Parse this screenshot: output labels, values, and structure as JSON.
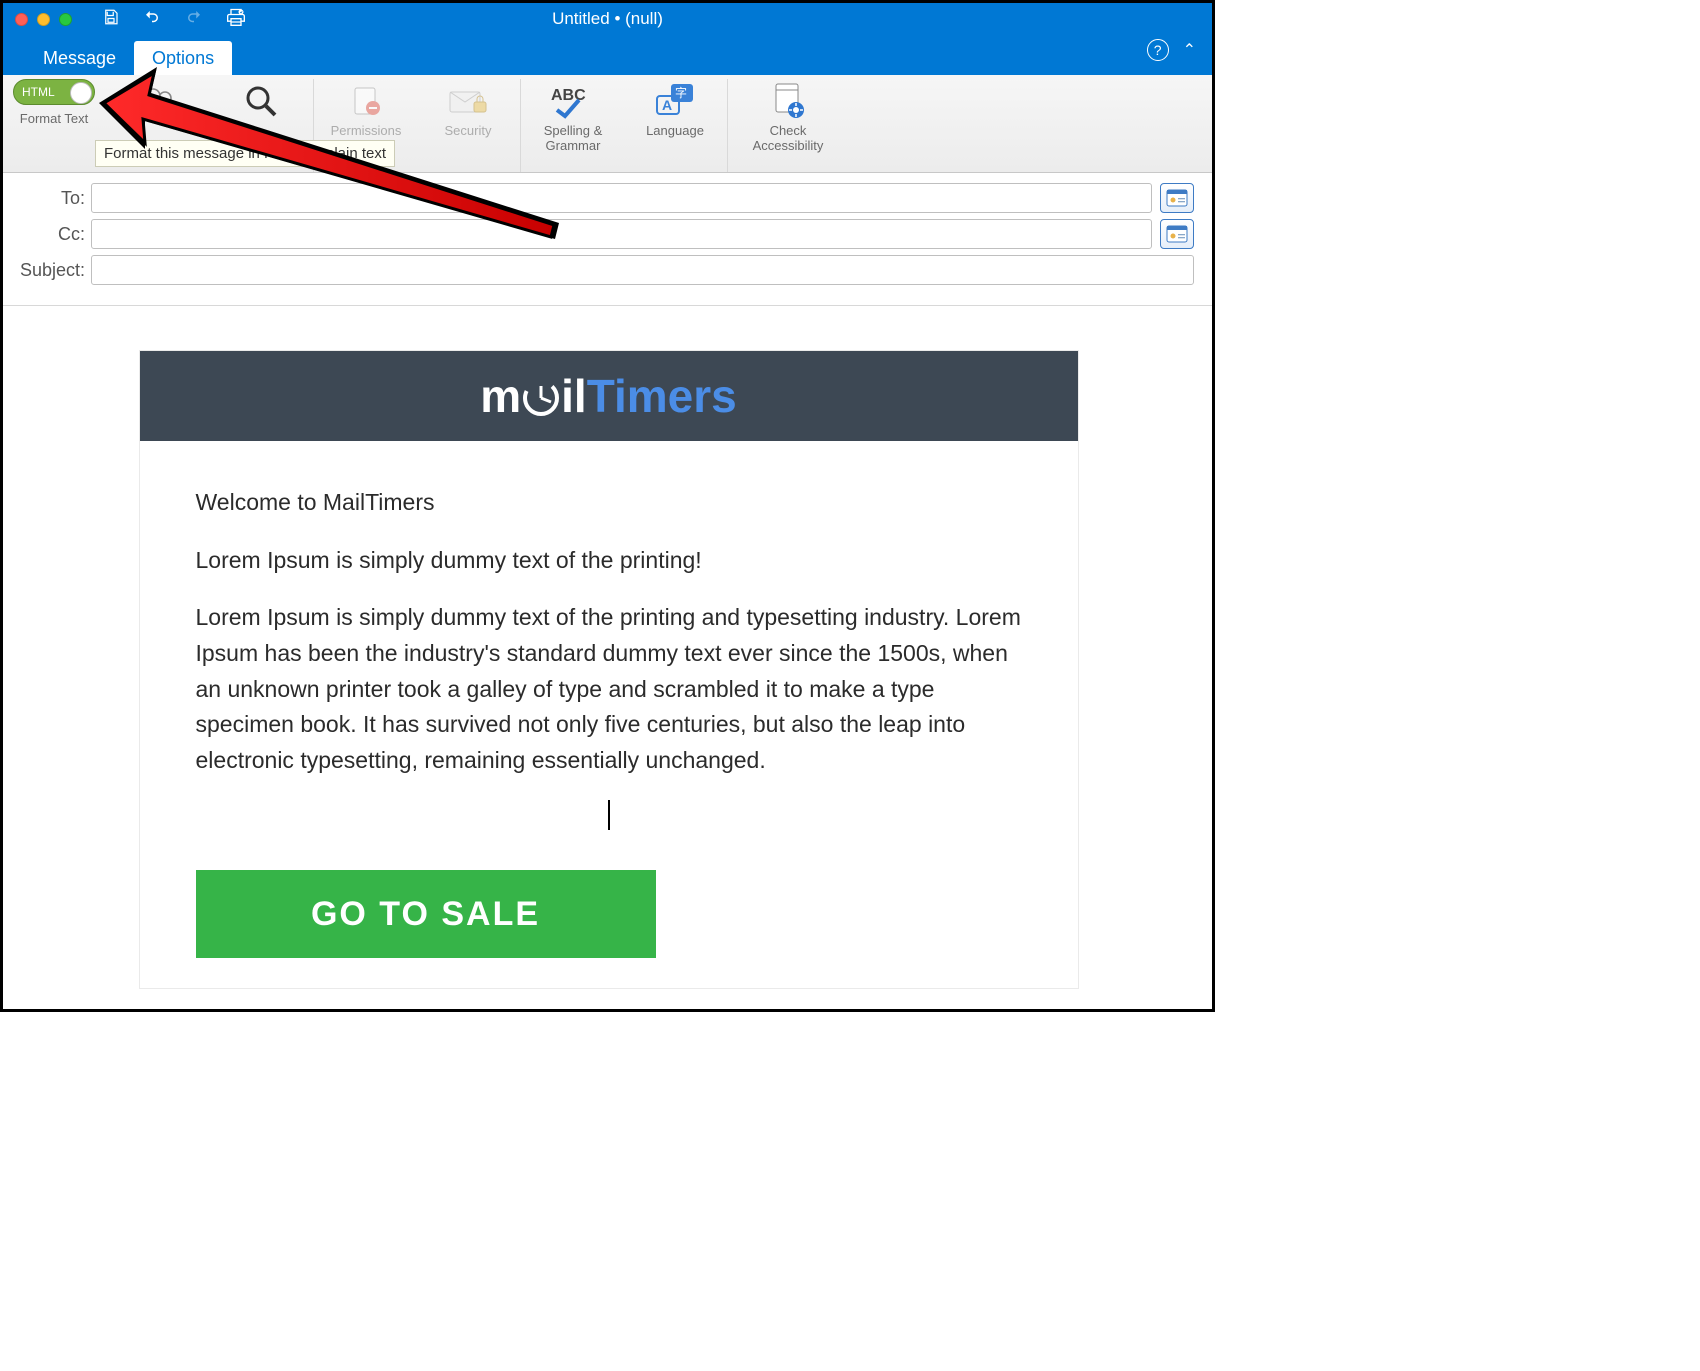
{
  "window": {
    "title": "Untitled • (null)"
  },
  "tabs": {
    "message": "Message",
    "options": "Options"
  },
  "ribbon": {
    "format_toggle_label": "HTML",
    "format_text_label": "Format Text",
    "tooltip": "Format this message in HTML or plain text",
    "permissions": "Permissions",
    "security": "Security",
    "spelling": "Spelling & Grammar",
    "language": "Language",
    "accessibility": "Check Accessibility"
  },
  "headers": {
    "to": "To:",
    "cc": "Cc:",
    "subject": "Subject:",
    "to_value": "",
    "cc_value": "",
    "subject_value": ""
  },
  "email": {
    "logo_part1": "m",
    "logo_part2": "il",
    "logo_part3": "Timers",
    "welcome": "Welcome to MailTimers",
    "intro": "Lorem Ipsum is simply dummy text of the printing!",
    "body": "Lorem Ipsum is simply dummy text of the printing and typesetting industry. Lorem Ipsum has been the industry's standard dummy text ever since the 1500s, when an unknown printer took a galley of type and scrambled it to make a type specimen book. It has survived not only five centuries, but also the leap into electronic typesetting, remaining essentially unchanged.",
    "cta": "GO TO SALE"
  }
}
